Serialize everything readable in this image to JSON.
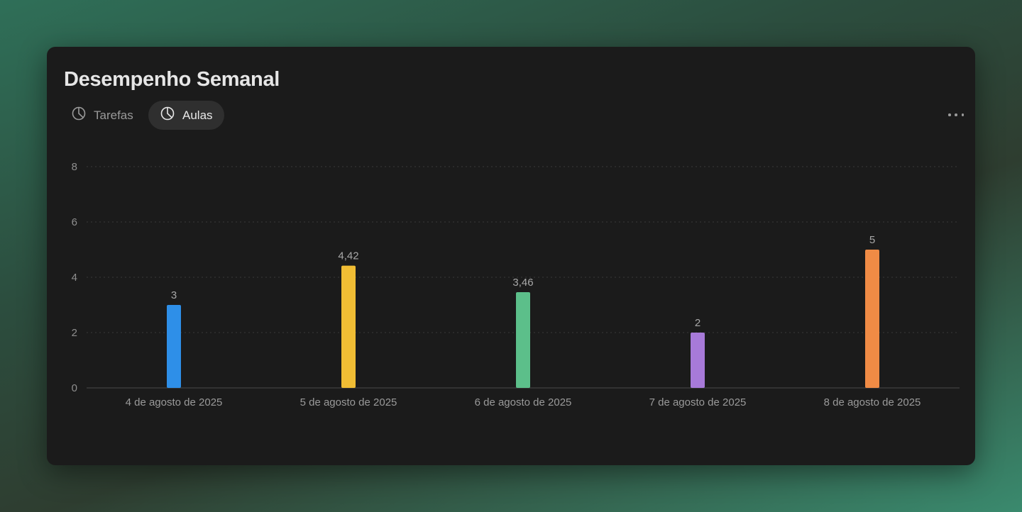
{
  "card": {
    "title": "Desempenho Semanal",
    "tabs": [
      {
        "label": "Tarefas",
        "icon": "pie-chart-icon",
        "active": false
      },
      {
        "label": "Aulas",
        "icon": "pie-chart-icon",
        "active": true
      }
    ],
    "menu_icon": "more-options-icon"
  },
  "chart_data": {
    "type": "bar",
    "categories": [
      "4 de agosto de 2025",
      "5 de agosto de 2025",
      "6 de agosto de 2025",
      "7 de agosto de 2025",
      "8 de agosto de 2025"
    ],
    "values": [
      3,
      4.42,
      3.46,
      2,
      5
    ],
    "value_labels": [
      "3",
      "4,42",
      "3,46",
      "2",
      "5"
    ],
    "colors": [
      "#2e8fe8",
      "#f0bd34",
      "#5cbf8a",
      "#a77ad9",
      "#f08b45"
    ],
    "yticks": [
      0,
      2,
      4,
      6,
      8
    ],
    "ylim": [
      0,
      8
    ],
    "grid": true,
    "legend": false
  }
}
